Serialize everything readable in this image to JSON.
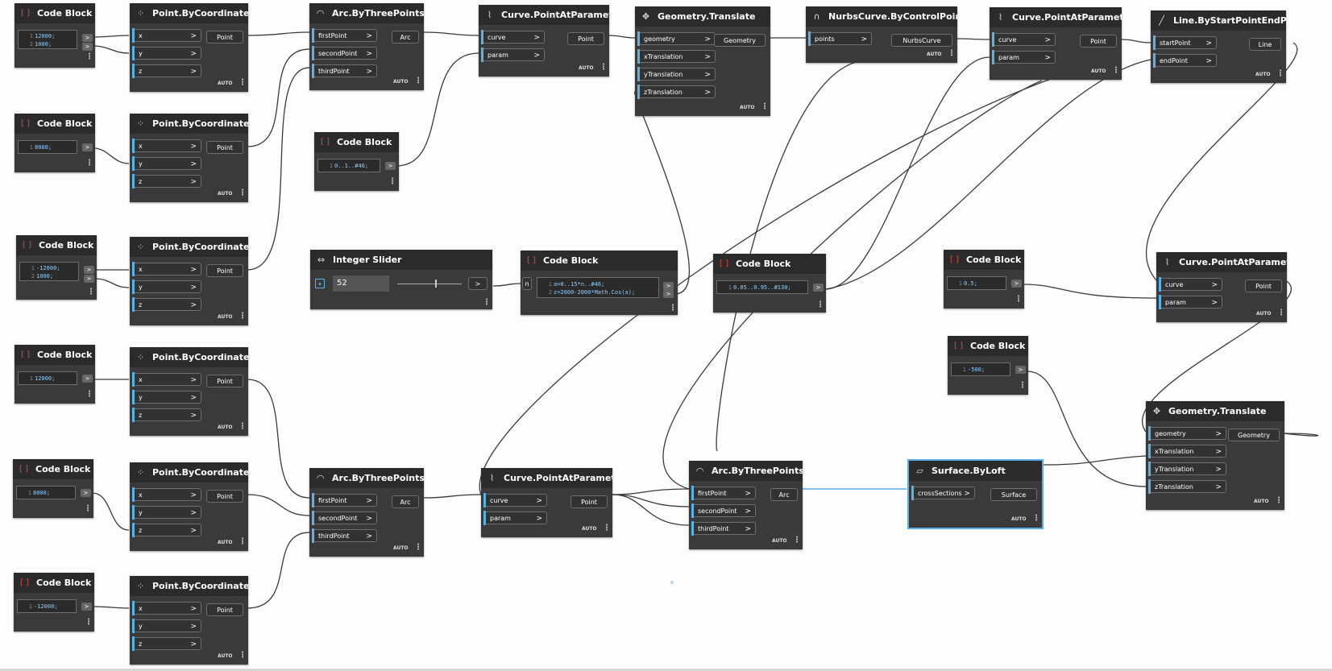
{
  "common": {
    "auto": "AUTO",
    "menu": "⋮",
    "arrow": ">"
  },
  "slider": {
    "title": "Integer Slider",
    "value": "52",
    "expander": "▾",
    "out": ">"
  },
  "code_blocks": [
    {
      "title": "Code Block",
      "lines": [
        "12000;",
        "1000;"
      ]
    },
    {
      "title": "Code Block",
      "lines": [
        "8000;"
      ]
    },
    {
      "title": "Code Block",
      "lines": [
        "-12000;",
        "1000;"
      ]
    },
    {
      "title": "Code Block",
      "lines": [
        "12000;"
      ]
    },
    {
      "title": "Code Block",
      "lines": [
        "8000;"
      ]
    },
    {
      "title": "Code Block",
      "lines": [
        "-12000;"
      ]
    },
    {
      "title": "Code Block",
      "lines": [
        "0..1..#46;"
      ]
    },
    {
      "title": "Code Block",
      "lines": [
        "a=0..15*n..#46;",
        "z=2000-2000*Math.Cos(a);"
      ],
      "input": "n"
    },
    {
      "title": "Code Block",
      "lines": [
        "0.05..0.95..#130;"
      ]
    },
    {
      "title": "Code Block",
      "lines": [
        "0.5;"
      ]
    },
    {
      "title": "Code Block",
      "lines": [
        "-500;"
      ]
    }
  ],
  "nodes": [
    {
      "title": "Point.ByCoordinates",
      "inputs": [
        "x",
        "y",
        "z"
      ],
      "output": "Point"
    },
    {
      "title": "Point.ByCoordinates",
      "inputs": [
        "x",
        "y",
        "z"
      ],
      "output": "Point"
    },
    {
      "title": "Point.ByCoordinates",
      "inputs": [
        "x",
        "y",
        "z"
      ],
      "output": "Point"
    },
    {
      "title": "Point.ByCoordinates",
      "inputs": [
        "x",
        "y",
        "z"
      ],
      "output": "Point"
    },
    {
      "title": "Point.ByCoordinates",
      "inputs": [
        "x",
        "y",
        "z"
      ],
      "output": "Point"
    },
    {
      "title": "Point.ByCoordinates",
      "inputs": [
        "x",
        "y",
        "z"
      ],
      "output": "Point"
    },
    {
      "title": "Arc.ByThreePoints",
      "inputs": [
        "firstPoint",
        "secondPoint",
        "thirdPoint"
      ],
      "output": "Arc"
    },
    {
      "title": "Curve.PointAtParameter",
      "inputs": [
        "curve",
        "param"
      ],
      "output": "Point"
    },
    {
      "title": "Geometry.Translate",
      "inputs": [
        "geometry",
        "xTranslation",
        "yTranslation",
        "zTranslation"
      ],
      "output": "Geometry"
    },
    {
      "title": "NurbsCurve.ByControlPoints",
      "inputs": [
        "points"
      ],
      "output": "NurbsCurve"
    },
    {
      "title": "Curve.PointAtParameter",
      "inputs": [
        "curve",
        "param"
      ],
      "output": "Point"
    },
    {
      "title": "Line.ByStartPointEndPoint",
      "inputs": [
        "startPoint",
        "endPoint"
      ],
      "output": "Line"
    },
    {
      "title": "Curve.PointAtParameter",
      "inputs": [
        "curve",
        "param"
      ],
      "output": "Point"
    },
    {
      "title": "Arc.ByThreePoints",
      "inputs": [
        "firstPoint",
        "secondPoint",
        "thirdPoint"
      ],
      "output": "Arc"
    },
    {
      "title": "Curve.PointAtParameter",
      "inputs": [
        "curve",
        "param"
      ],
      "output": "Point"
    },
    {
      "title": "Arc.ByThreePoints",
      "inputs": [
        "firstPoint",
        "secondPoint",
        "thirdPoint"
      ],
      "output": "Arc"
    },
    {
      "title": "Surface.ByLoft",
      "inputs": [
        "crossSections"
      ],
      "output": "Surface"
    },
    {
      "title": "Geometry.Translate",
      "inputs": [
        "geometry",
        "xTranslation",
        "yTranslation",
        "zTranslation"
      ],
      "output": "Geometry"
    }
  ]
}
